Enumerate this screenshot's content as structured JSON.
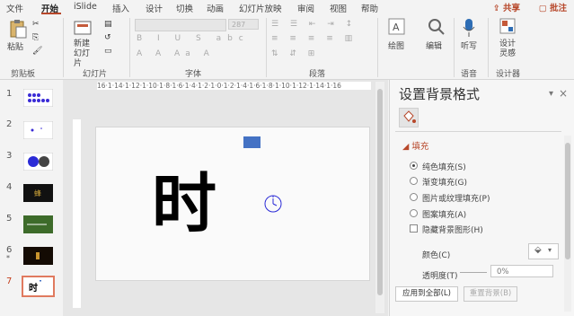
{
  "menu": {
    "tabs": [
      "文件",
      "开始",
      "iSlide",
      "插入",
      "设计",
      "切换",
      "动画",
      "幻灯片放映",
      "审阅",
      "视图",
      "帮助"
    ],
    "share": "共享",
    "comment": "批注"
  },
  "ribbon": {
    "paste": "粘贴",
    "clipboard": "剪贴板",
    "new_slide": "新建\n幻灯片",
    "slides_group": "幻灯片",
    "font_group": "字体",
    "font_size": "287",
    "paragraph_group": "段落",
    "drawing": "绘图",
    "editing": "编辑",
    "dictate": "听写",
    "designer": "设计\n灵感",
    "voice_group": "语音",
    "designer_group": "设计器"
  },
  "thumbnails": [
    {
      "num": "1"
    },
    {
      "num": "2"
    },
    {
      "num": "3"
    },
    {
      "num": "4"
    },
    {
      "num": "5"
    },
    {
      "num": "6"
    },
    {
      "num": "7"
    }
  ],
  "ruler_text": "16·1·14·1·12·1·10·1·8·1·6·1·4·1·2·1·0·1·2·1·4·1·6·1·8·1·10·1·12·1·14·1·16",
  "slide": {
    "title": "时"
  },
  "panel": {
    "title": "设置背景格式",
    "fill_header": "填充",
    "options": [
      "纯色填充(S)",
      "渐变填充(G)",
      "图片或纹理填充(P)",
      "图案填充(A)"
    ],
    "hide_bg": "隐藏背景图形(H)",
    "color_label": "颜色(C)",
    "transparency_label": "透明度(T)",
    "transparency_value": "0%",
    "apply_all": "应用到全部(L)",
    "reset": "重置背景(B)"
  },
  "colors": {
    "accent": "#b7472a",
    "shape": "#4472c4",
    "clock": "#2b2bd6"
  }
}
